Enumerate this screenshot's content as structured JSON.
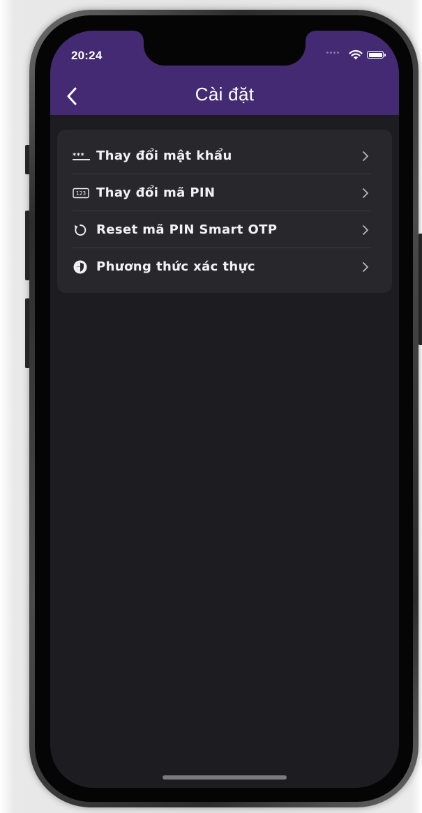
{
  "status_bar": {
    "time": "20:24"
  },
  "nav_bar": {
    "title": "Cài đặt",
    "back_icon": "chevron-left-icon"
  },
  "settings": {
    "items": [
      {
        "label": "Thay đổi mật khẩu",
        "icon": "password-icon"
      },
      {
        "label": "Thay đổi mã PIN",
        "icon": "pin-code-icon",
        "icon_text": "123"
      },
      {
        "label": "Reset mã PIN Smart OTP",
        "icon": "reset-icon"
      },
      {
        "label": "Phương thức xác thực",
        "icon": "shield-icon"
      }
    ]
  },
  "colors": {
    "nav_background": "#432a72",
    "screen_background": "#1d1c21",
    "card_background": "#28272c",
    "text_primary": "#f2f2f4",
    "chevron": "#b8b7bd"
  }
}
